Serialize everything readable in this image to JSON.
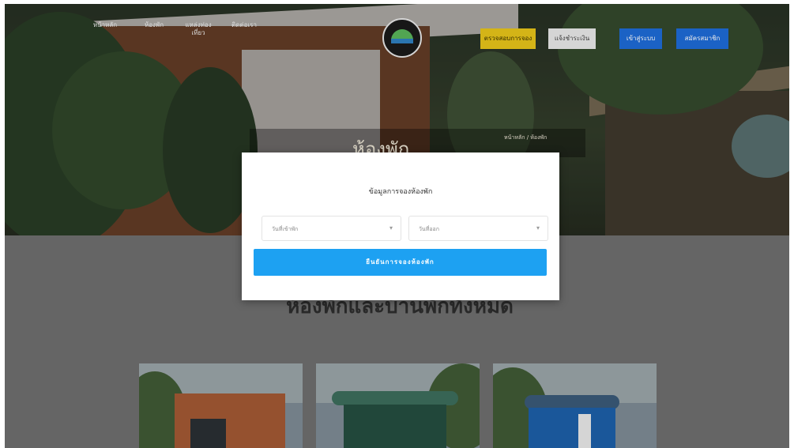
{
  "nav": {
    "items": [
      "หน้าหลัก",
      "ห้องพัก",
      "แหล่งท่องเที่ยว",
      "ติดต่อเรา"
    ]
  },
  "header_buttons": {
    "check_booking": "ตรวจสอบการจอง",
    "booking_payment": "แจ้งชำระเงิน",
    "login": "เข้าสู่ระบบ",
    "register": "สมัครสมาชิก"
  },
  "hero": {
    "title": "ห้องพัก",
    "subtitle": "หน้าหลัก / ห้องพัก"
  },
  "section": {
    "heading": "ห้องพักและบ้านพักทั้งหมด"
  },
  "modal": {
    "title": "ข้อมูลการจองห้องพัก",
    "checkin_value": "วันที่เข้าพัก",
    "checkout_value": "วันที่ออก",
    "submit_label": "ยืนยันการจองห้องพัก"
  },
  "colors": {
    "accent_blue": "#1da1f2",
    "yellow_button": "#e6c41a",
    "nav_blue": "#1e6bd6"
  }
}
